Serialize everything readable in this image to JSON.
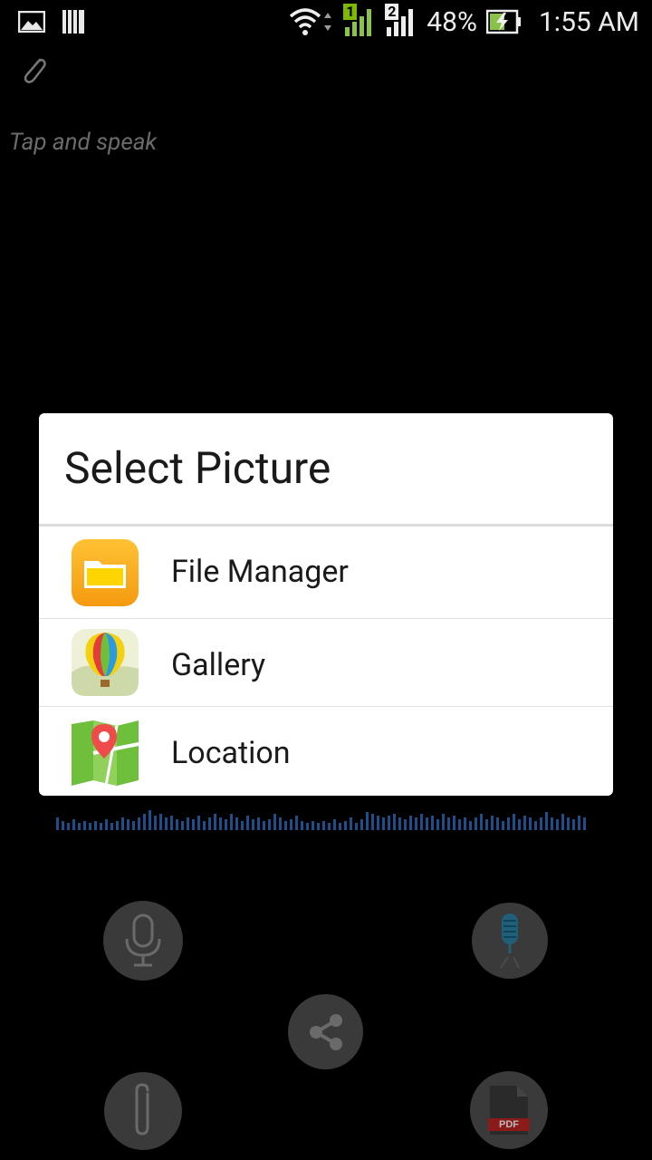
{
  "status_bar": {
    "battery_percent": "48%",
    "time": "1:55 AM",
    "sim1": "1",
    "sim2": "2"
  },
  "editor": {
    "placeholder": "Tap and speak"
  },
  "dialog": {
    "title": "Select Picture",
    "items": [
      {
        "label": "File Manager",
        "icon": "file-manager-icon"
      },
      {
        "label": "Gallery",
        "icon": "gallery-icon"
      },
      {
        "label": "Location",
        "icon": "location-icon"
      }
    ]
  },
  "bottom_controls": {
    "pdf_label": "PDF"
  }
}
